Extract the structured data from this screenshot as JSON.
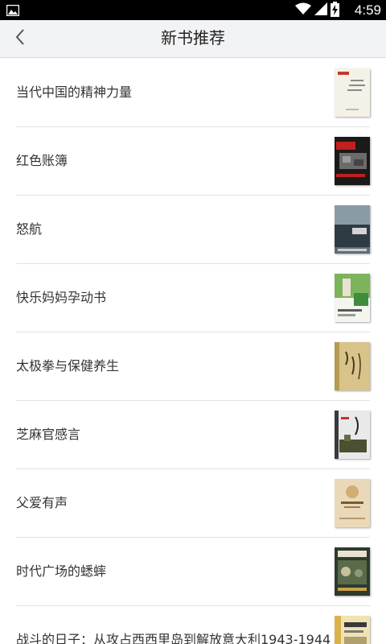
{
  "status_bar": {
    "time": "4:59",
    "icons": [
      "image-notification-icon",
      "wifi-icon",
      "signal-icon",
      "battery-charging-icon"
    ]
  },
  "header": {
    "title": "新书推荐",
    "back_icon": "chevron-left-icon"
  },
  "books": [
    {
      "title": "当代中国的精神力量",
      "cover_color": "#f4f1e6"
    },
    {
      "title": "红色账簿",
      "cover_color": "#1a1a1a"
    },
    {
      "title": "怒航",
      "cover_color": "#3a4a55"
    },
    {
      "title": "快乐妈妈孕动书",
      "cover_color": "#6aa34a"
    },
    {
      "title": "太极拳与保健养生",
      "cover_color": "#d8c48a"
    },
    {
      "title": "芝麻官感言",
      "cover_color": "#e9e9e9"
    },
    {
      "title": "父爱有声",
      "cover_color": "#ead9b8"
    },
    {
      "title": "时代广场的蟋蟀",
      "cover_color": "#2d3b2d"
    },
    {
      "title": "战斗的日子：从攻占西西里岛到解放意大利1943-1944",
      "cover_color": "#f0e3b0"
    }
  ]
}
